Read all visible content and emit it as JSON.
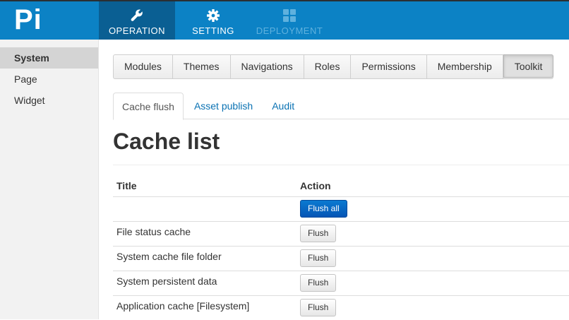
{
  "brand": {
    "logo_text": "Pi"
  },
  "topnav": {
    "items": [
      {
        "label": "OPERATION",
        "icon": "wrench-icon",
        "state": "active"
      },
      {
        "label": "SETTING",
        "icon": "gear-icon",
        "state": "normal"
      },
      {
        "label": "DEPLOYMENT",
        "icon": "grid-icon",
        "state": "disabled"
      }
    ]
  },
  "sidebar": {
    "items": [
      {
        "label": "System",
        "active": true
      },
      {
        "label": "Page",
        "active": false
      },
      {
        "label": "Widget",
        "active": false
      }
    ]
  },
  "module_tabs": [
    {
      "label": "Modules"
    },
    {
      "label": "Themes"
    },
    {
      "label": "Navigations"
    },
    {
      "label": "Roles"
    },
    {
      "label": "Permissions"
    },
    {
      "label": "Membership"
    },
    {
      "label": "Toolkit",
      "active": true
    }
  ],
  "sub_tabs": [
    {
      "label": "Cache flush",
      "active": true
    },
    {
      "label": "Asset publish"
    },
    {
      "label": "Audit"
    }
  ],
  "page": {
    "title": "Cache list"
  },
  "table": {
    "headers": {
      "title": "Title",
      "action": "Action"
    },
    "flush_all_label": "Flush all",
    "rows": [
      {
        "title": "File status cache",
        "action": "Flush"
      },
      {
        "title": "System cache file folder",
        "action": "Flush"
      },
      {
        "title": "System persistent data",
        "action": "Flush"
      },
      {
        "title": "Application cache [Filesystem]",
        "action": "Flush"
      }
    ]
  },
  "colors": {
    "topbar": "#0c82c5",
    "topnav_active": "#0a5f93",
    "link": "#0a72b3",
    "primary_button": "#0555b5"
  }
}
